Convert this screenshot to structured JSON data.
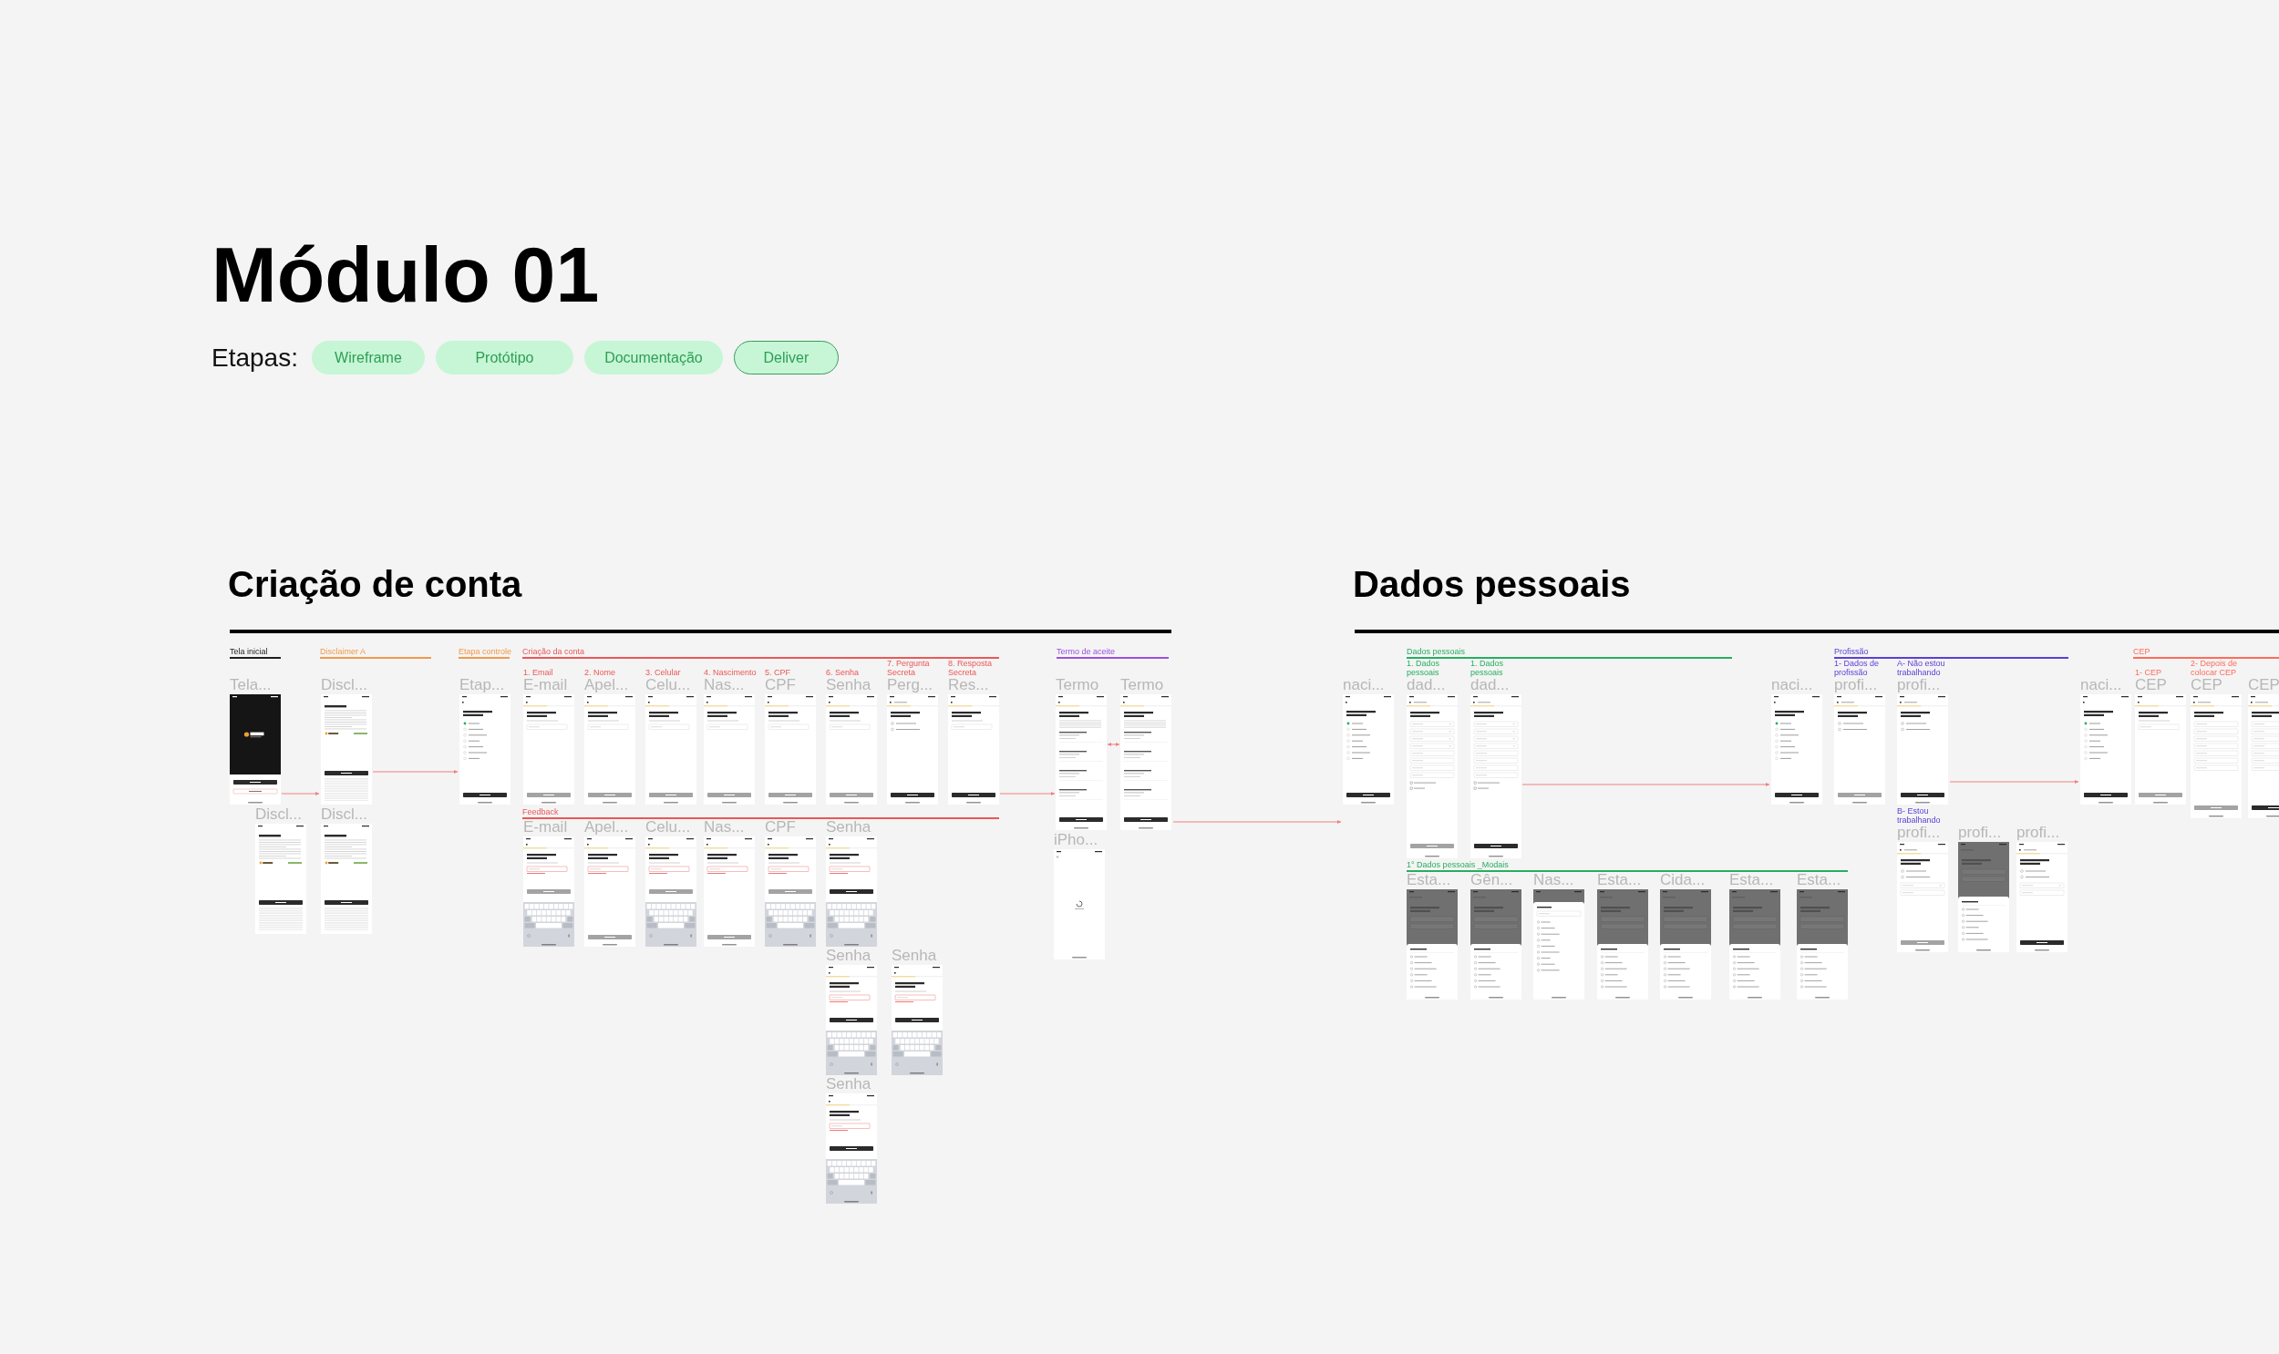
{
  "title": "Módulo 01",
  "stages": {
    "label": "Etapas:",
    "items": [
      {
        "label": "Wireframe",
        "selected": false
      },
      {
        "label": "Protótipo",
        "selected": false
      },
      {
        "label": "Documentação",
        "selected": false
      },
      {
        "label": "Deliver",
        "selected": true
      }
    ]
  },
  "sections": [
    {
      "title": "Criação de conta",
      "groups": [
        {
          "label": "Tela inicial",
          "color": "#1e1e1e",
          "frames": [
            {
              "name": "Tela...",
              "kind": "splash"
            }
          ]
        },
        {
          "label": "Disclaimer A",
          "color": "#f2994a",
          "frames": [
            {
              "name": "Discl...",
              "kind": "article",
              "disabled": false
            },
            {
              "name": "Discl...",
              "kind": "article",
              "disabled": false
            },
            {
              "name": "Discl...",
              "kind": "article",
              "disabled": false
            }
          ]
        },
        {
          "label": "Etapa controle",
          "color": "#f2994a",
          "frames": [
            {
              "name": "Etap...",
              "kind": "checklist",
              "disabled": false
            }
          ]
        },
        {
          "label": "Criação da conta",
          "color": "#eb5757",
          "frames": [
            {
              "caption": "1. Email",
              "name": "E-mail",
              "kind": "form",
              "disabled": true
            },
            {
              "caption": "2. Nome",
              "name": "Apel...",
              "kind": "form",
              "disabled": true
            },
            {
              "caption": "3. Celular",
              "name": "Celu...",
              "kind": "form",
              "disabled": true
            },
            {
              "caption": "4. Nascimento",
              "name": "Nas...",
              "kind": "form",
              "disabled": true
            },
            {
              "caption": "5. CPF",
              "name": "CPF",
              "kind": "form",
              "disabled": true
            },
            {
              "caption": "6. Senha",
              "name": "Senha",
              "kind": "form",
              "disabled": true
            },
            {
              "caption": "7. Pergunta Secreta",
              "name": "Perg...",
              "kind": "choice",
              "disabled": false
            },
            {
              "caption": "8. Resposta Secreta",
              "name": "Res...",
              "kind": "form",
              "disabled": false
            }
          ]
        },
        {
          "label": "Feedback",
          "color": "#eb5757",
          "frames": [
            {
              "name": "E-mail",
              "kind": "form-keyboard",
              "disabled": true
            },
            {
              "name": "Apel...",
              "kind": "form-error",
              "disabled": true
            },
            {
              "name": "Celu...",
              "kind": "form-keyboard",
              "disabled": true
            },
            {
              "name": "Nas...",
              "kind": "form-error",
              "disabled": true
            },
            {
              "name": "CPF",
              "kind": "form-keyboard",
              "disabled": true
            },
            {
              "name": "Senha",
              "kind": "form-keyboard",
              "disabled": false
            },
            {
              "name": "Senha",
              "kind": "form-keyboard",
              "disabled": false
            },
            {
              "name": "Senha",
              "kind": "form-keyboard",
              "disabled": false
            },
            {
              "name": "Senha",
              "kind": "form-keyboard",
              "disabled": false
            }
          ]
        },
        {
          "label": "Termo de aceite",
          "color": "#9b51e0",
          "frames": [
            {
              "name": "Termo",
              "kind": "terms",
              "disabled": false
            },
            {
              "name": "Termo",
              "kind": "terms",
              "disabled": false
            },
            {
              "name": "iPho...",
              "kind": "loading"
            }
          ]
        }
      ]
    },
    {
      "title": "Dados pessoais",
      "groups": [
        {
          "label": "Dados pessoais",
          "color": "#27ae60",
          "frames": [
            {
              "name": "naci...",
              "kind": "checklist",
              "disabled": false
            },
            {
              "caption": "1. Dados pessoais",
              "name": "dad...",
              "kind": "form-long",
              "disabled": true
            },
            {
              "caption": "1. Dados pessoais",
              "name": "dad...",
              "kind": "form-long",
              "disabled": false
            }
          ]
        },
        {
          "label": "1° Dados pessoais _Modais",
          "color": "#27ae60",
          "frames": [
            {
              "name": "Esta...",
              "kind": "modal"
            },
            {
              "name": "Gên...",
              "kind": "modal"
            },
            {
              "name": "Nas...",
              "kind": "sheet"
            },
            {
              "name": "Esta...",
              "kind": "modal"
            },
            {
              "name": "Cida...",
              "kind": "modal"
            },
            {
              "name": "Esta...",
              "kind": "modal"
            },
            {
              "name": "Esta...",
              "kind": "modal"
            }
          ]
        },
        {
          "label": "Profissão",
          "color": "#5b3fd6",
          "frames": [
            {
              "name": "naci...",
              "kind": "checklist",
              "disabled": false
            },
            {
              "caption": "1- Dados de profissão",
              "name": "profi...",
              "kind": "choice",
              "disabled": true
            },
            {
              "caption": "A- Não estou trabalhando",
              "name": "profi...",
              "kind": "choice",
              "disabled": false
            },
            {
              "caption": "B- Estou trabalhando",
              "name": "profi...",
              "kind": "choice-form",
              "disabled": true
            },
            {
              "name": "profi...",
              "kind": "modal"
            },
            {
              "name": "profi...",
              "kind": "choice-form",
              "disabled": false
            }
          ]
        },
        {
          "label": "CEP",
          "color": "#ff6b5b",
          "frames": [
            {
              "name": "naci...",
              "kind": "checklist",
              "disabled": false
            },
            {
              "caption": "1- CEP",
              "name": "CEP",
              "kind": "form",
              "disabled": true
            },
            {
              "caption": "2- Depois de colocar CEP",
              "name": "CEP",
              "kind": "address",
              "disabled": true
            },
            {
              "name": "CEP",
              "kind": "address",
              "disabled": false
            }
          ]
        }
      ]
    }
  ]
}
